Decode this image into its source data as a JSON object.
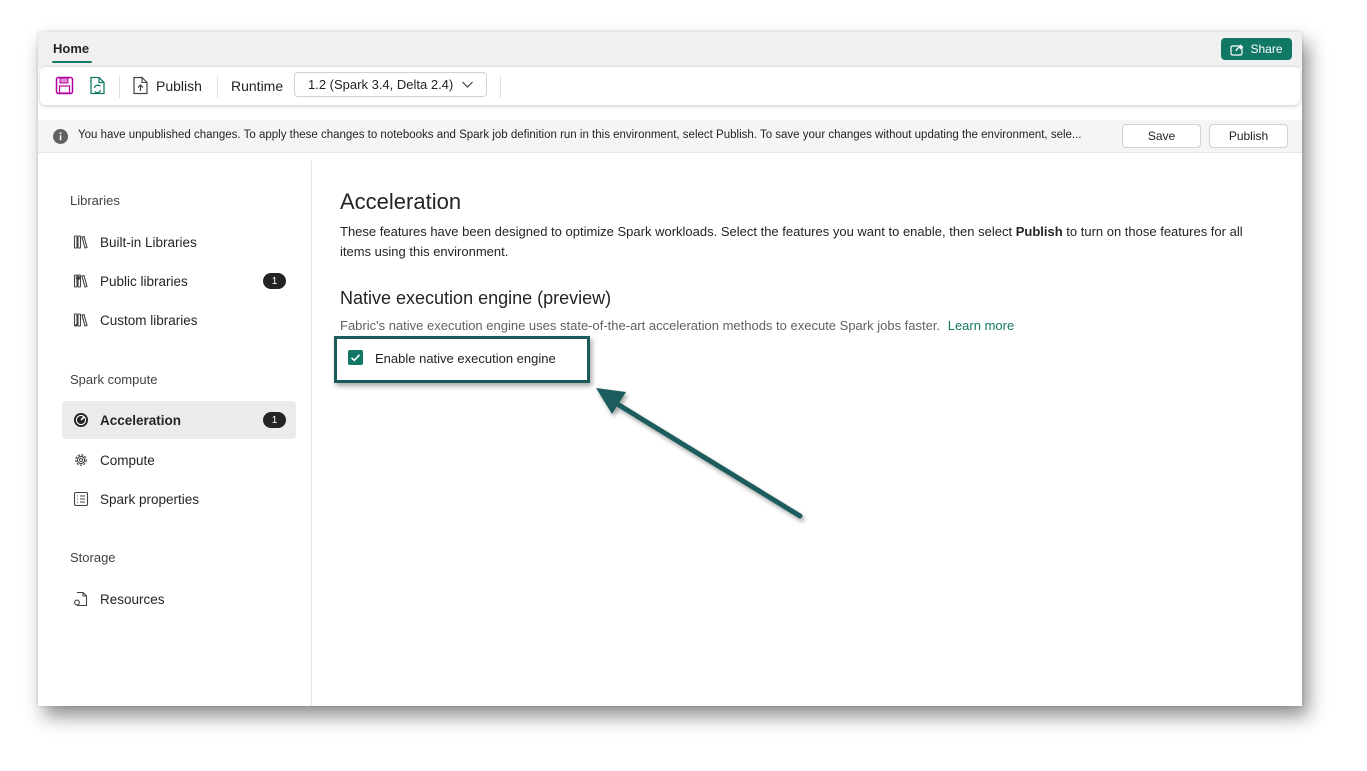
{
  "header": {
    "home_tab": "Home",
    "share_label": "Share"
  },
  "toolbar": {
    "publish_label": "Publish",
    "runtime_label": "Runtime",
    "runtime_value": "1.2 (Spark 3.4, Delta 2.4)"
  },
  "banner": {
    "message": "You have unpublished changes. To apply these changes to notebooks and Spark job definition run in this environment, select Publish. To save your changes without updating the environment, sele...",
    "save_label": "Save",
    "publish_label": "Publish"
  },
  "sidebar": {
    "sections": [
      {
        "title": "Libraries",
        "items": [
          {
            "label": "Built-in Libraries",
            "icon": "library-books-icon"
          },
          {
            "label": "Public libraries",
            "icon": "public-library-icon",
            "badge": "1"
          },
          {
            "label": "Custom libraries",
            "icon": "custom-library-icon"
          }
        ]
      },
      {
        "title": "Spark compute",
        "items": [
          {
            "label": "Acceleration",
            "icon": "gauge-icon",
            "badge": "1",
            "active": true
          },
          {
            "label": "Compute",
            "icon": "gear-icon"
          },
          {
            "label": "Spark properties",
            "icon": "properties-list-icon"
          }
        ]
      },
      {
        "title": "Storage",
        "items": [
          {
            "label": "Resources",
            "icon": "document-resource-icon"
          }
        ]
      }
    ]
  },
  "main": {
    "title": "Acceleration",
    "desc_part1": "These features have been designed to optimize Spark workloads. Select the features you want to enable, then select ",
    "desc_bold": "Publish",
    "desc_part2": " to turn on those features for all items using this environment.",
    "native": {
      "title": "Native execution engine (preview)",
      "desc": "Fabric's native execution engine uses state-of-the-art acceleration methods to execute Spark jobs faster.",
      "learn_more": "Learn more",
      "checkbox_label": "Enable native execution engine",
      "checked": true
    }
  },
  "colors": {
    "accent": "#117865",
    "highlight_border": "#1b5b5b",
    "save_icon": "#b4009e"
  }
}
